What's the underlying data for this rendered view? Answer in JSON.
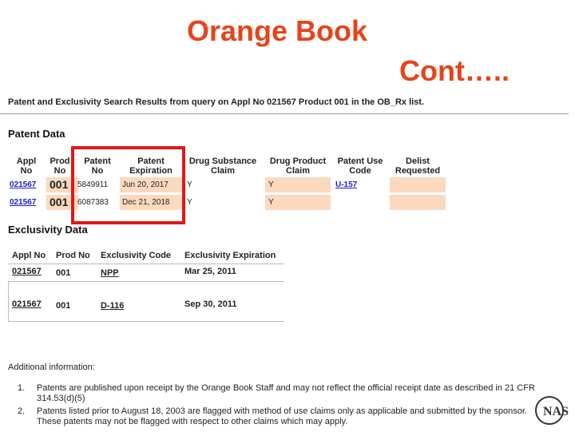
{
  "slide": {
    "title_line1": "Orange Book",
    "title_line2": "Cont….."
  },
  "query": "Patent and Exclusivity Search Results from query on Appl No 021567 Product 001 in the OB_Rx list.",
  "patent_section_title": "Patent Data",
  "patent_headers": [
    "Appl No",
    "Prod No",
    "Patent No",
    "Patent Expiration",
    "Drug Substance Claim",
    "Drug Product Claim",
    "Patent Use Code",
    "Delist Requested"
  ],
  "patent_rows": [
    {
      "appl": "021567",
      "prod": "001",
      "patent": "5849911",
      "exp": "Jun 20, 2017",
      "sub": "Y",
      "prd": "Y",
      "use": "U-157",
      "delist": ""
    },
    {
      "appl": "021567",
      "prod": "001",
      "patent": "6087383",
      "exp": "Dec 21, 2018",
      "sub": "Y",
      "prd": "Y",
      "use": "",
      "delist": ""
    }
  ],
  "excl_section_title": "Exclusivity Data",
  "excl_headers": [
    "Appl No",
    "Prod No",
    "Exclusivity Code",
    "Exclusivity Expiration"
  ],
  "excl_rows": [
    {
      "appl": "021567",
      "prod": "001",
      "code": "NPP",
      "exp": "Mar 25, 2011"
    },
    {
      "appl": "021567",
      "prod": "001",
      "code": "D-116",
      "exp": "Sep 30, 2011"
    }
  ],
  "additional_title": "Additional information:",
  "notes": [
    {
      "num": "1.",
      "text": "Patents are published upon receipt by the Orange Book Staff and may not reflect the official receipt date as described in 21 CFR 314.53(d)(5)"
    },
    {
      "num": "2.",
      "text": "Patents listed prior to August 18, 2003 are flagged with method of use claims only as applicable and submitted by the sponsor. These patents may not be flagged with respect to other claims which may apply."
    }
  ],
  "logo_text": "NAS",
  "colors": {
    "title": "#e8431a",
    "highlight_box": "#e01818",
    "cell_shade": "#fbd9bf",
    "link": "#1a1acc"
  }
}
